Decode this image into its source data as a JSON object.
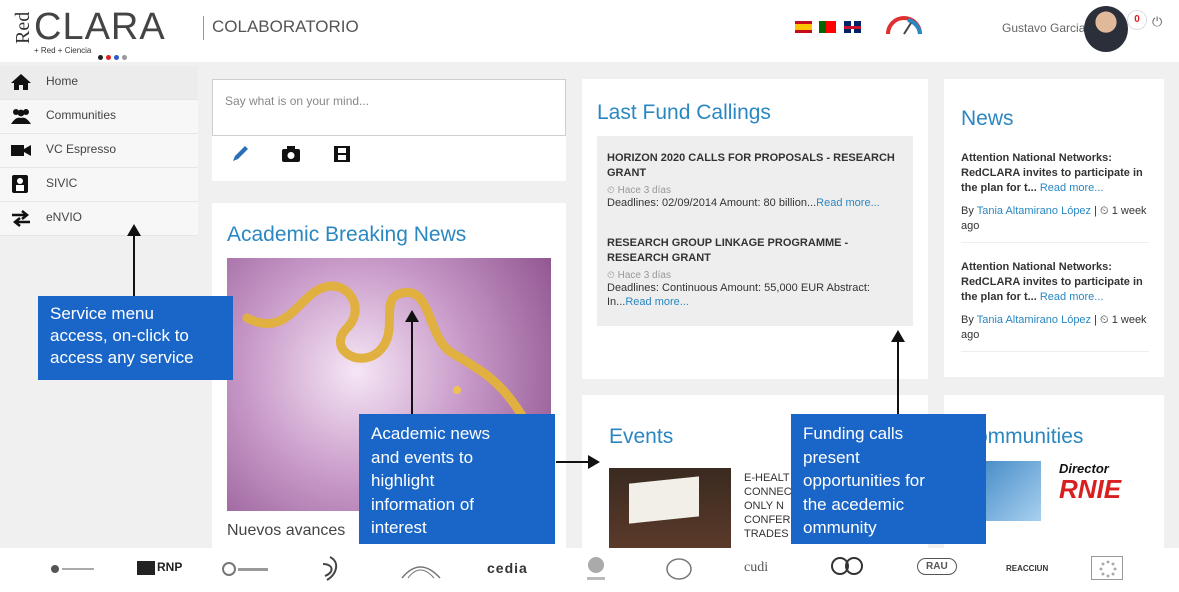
{
  "header": {
    "logo_red": "Red",
    "logo_clara": "CLARA",
    "logo_tagline": "+ Red  + Ciencia",
    "app_title": "COLABORATORIO",
    "user_name": "Gustavo Garcia",
    "notification_count": "0",
    "flag_colors": {
      "dot1": "#222222",
      "dot2": "#e02020",
      "dot3": "#2a5cc8",
      "dot4": "#999999"
    }
  },
  "sidebar": {
    "items": [
      {
        "label": "Home",
        "icon": "home-icon"
      },
      {
        "label": "Communities",
        "icon": "users-icon"
      },
      {
        "label": "VC Espresso",
        "icon": "video-camera-icon"
      },
      {
        "label": "SIVIC",
        "icon": "sivic-icon"
      },
      {
        "label": "eNVIO",
        "icon": "transfer-arrows-icon"
      }
    ]
  },
  "post": {
    "placeholder": "Say what is on your mind...",
    "tools": [
      "pencil-icon",
      "camera-icon",
      "film-icon"
    ]
  },
  "academic": {
    "title": "Academic Breaking News",
    "caption": "Nuevos avances"
  },
  "funds": {
    "title": "Last Fund Callings",
    "items": [
      {
        "title": "HORIZON 2020 CALLS FOR PROPOSALS - RESEARCH GRANT",
        "when": "Hace 3 días",
        "desc": "Deadlines: 02/09/2014 Amount: 80 billion...",
        "more": "Read more..."
      },
      {
        "title": "RESEARCH GROUP LINKAGE PROGRAMME - RESEARCH GRANT",
        "when": "Hace 3 días",
        "desc": "Deadlines: Continuous Amount: 55,000 EUR Abstract: In...",
        "more": "Read more..."
      }
    ]
  },
  "news": {
    "title": "News",
    "items": [
      {
        "title": "Attention National Networks: RedCLARA invites to participate in the plan for t...",
        "more": "Read more...",
        "by": "By",
        "author": "Tania Altamirano López",
        "ago": "1 week ago"
      },
      {
        "title": "Attention National Networks: RedCLARA invites to participate in the plan for t...",
        "more": "Read more...",
        "by": "By",
        "author": "Tania Altamirano López",
        "ago": "1 week ago"
      }
    ]
  },
  "events": {
    "title": "Events",
    "lines": [
      "E-HEALT",
      "CONNEC",
      "ONLY N",
      "CONFER",
      "TRADES"
    ]
  },
  "communities": {
    "title": "ommunities",
    "img_text1": "Director",
    "img_text2": "RNIE"
  },
  "callouts": {
    "service": [
      "Service menu",
      "access, on-click to",
      "access any service"
    ],
    "academic": [
      "Academic news",
      "and events to",
      "highlight",
      "information of",
      "interest"
    ],
    "funding": [
      "Funding calls",
      "present",
      "opportunities for",
      "the acedemic",
      "ommunity"
    ]
  },
  "footer": {
    "partners": [
      "RNP",
      "cedia",
      "cudi",
      "RAU",
      "REACCIUN"
    ]
  }
}
